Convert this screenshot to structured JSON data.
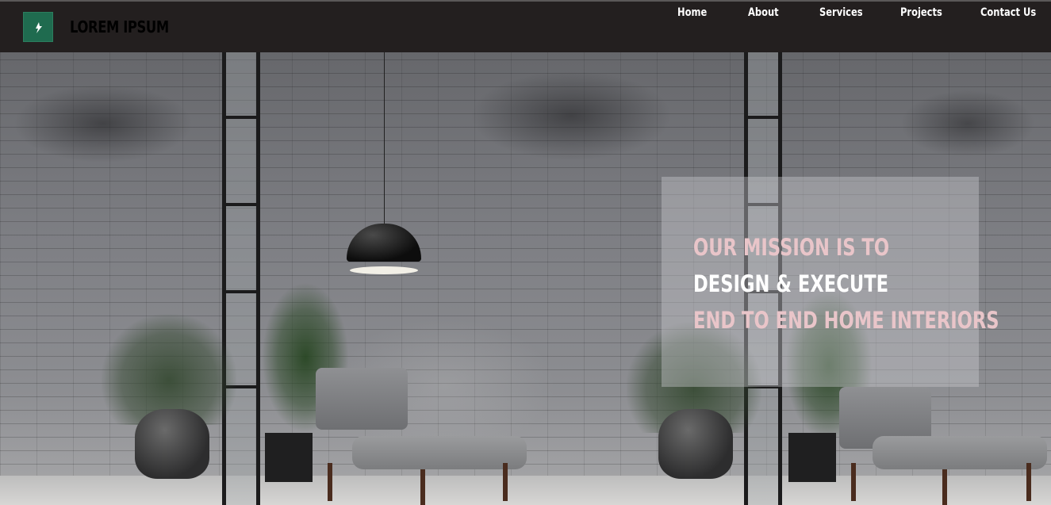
{
  "brand": {
    "name": "LOREM IPSUM",
    "logo_color": "#1f6b4f"
  },
  "nav": {
    "items": [
      {
        "label": "Home"
      },
      {
        "label": "About"
      },
      {
        "label": "Services"
      },
      {
        "label": "Projects"
      },
      {
        "label": "Contact Us"
      }
    ]
  },
  "hero": {
    "mission_line_1": "OUR MISSION IS TO",
    "mission_line_2": "DESIGN & EXECUTE",
    "mission_line_3": "END TO END HOME INTERIORS",
    "accent_color": "#e9c5c9"
  }
}
